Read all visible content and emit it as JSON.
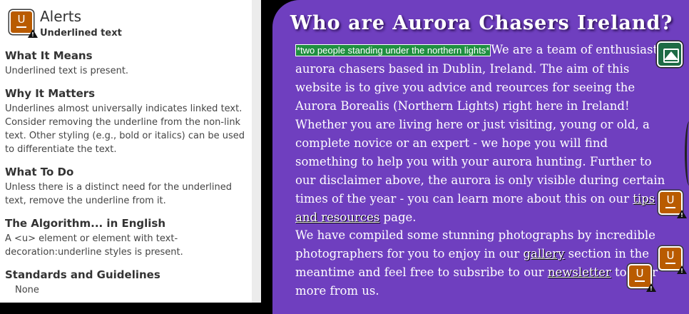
{
  "panel": {
    "title": "Alerts",
    "subtitle": "Underlined text",
    "icon": "underline-alert-icon",
    "sections": [
      {
        "heading": "What It Means",
        "body": "Underlined text is present."
      },
      {
        "heading": "Why It Matters",
        "body": "Underlines almost universally indicates linked text. Consider removing the underline from the non-link text. Other styling (e.g., bold or italics) can be used to differentiate the text."
      },
      {
        "heading": "What To Do",
        "body": "Unless there is a distinct need for the underlined text, remove the underline from it."
      },
      {
        "heading": "The Algorithm... in English",
        "body": "A <u> element or element with text-decoration:underline styles is present."
      },
      {
        "heading": "Standards and Guidelines",
        "body": "None"
      }
    ]
  },
  "page": {
    "heading": "Who are Aurora Chasers Ireland?",
    "alt_text": "*two people standing under the northern lights*",
    "para1": {
      "text_a": "We are a team of enthusiastic aurora chasers based in Dublin, Ireland. The aim of this website is to give you advice and reources for seeing the Aurora Borealis (Northern Lights) right here in Ireland! Whether you are living here or just visiting, young or old, a complete novice or an expert - we hope you will find something to help you with your aurora hunting. Further to our disclaimer above, the aurora is only visible during certain times of the year - you can learn more about this on our ",
      "link": "tips and resources",
      "text_b": " page."
    },
    "para2": {
      "text_a": "We have compiled some stunning photographs by incredible photographers for you to enjoy in our ",
      "link1": "gallery",
      "text_b": " section in the meantime and feel free to subsribe to our ",
      "link2": "newsletter",
      "text_c": " to hear more from us."
    }
  },
  "colors": {
    "accent_purple": "#6f3fbf",
    "alert_orange": "#b95b00",
    "alt_green": "#1f8f40"
  }
}
